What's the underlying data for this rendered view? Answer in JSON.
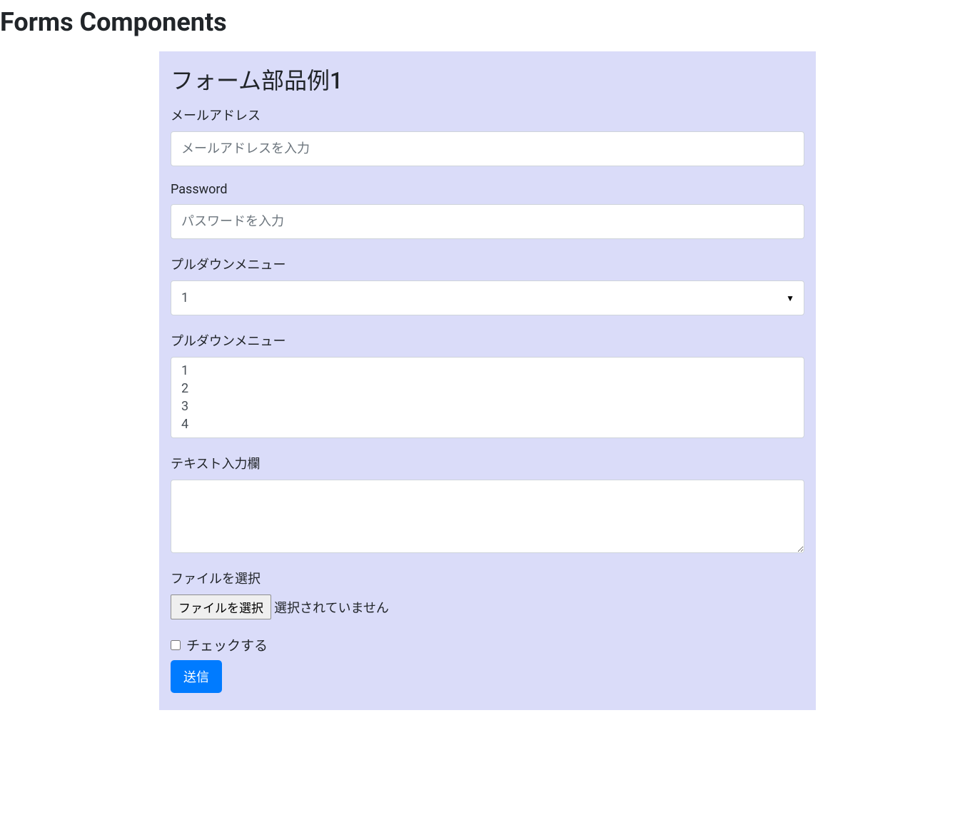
{
  "page": {
    "title": "Forms Components"
  },
  "form": {
    "header": "フォーム部品例1",
    "email": {
      "label": "メールアドレス",
      "placeholder": "メールアドレスを入力"
    },
    "password": {
      "label": "Password",
      "placeholder": "パスワードを入力"
    },
    "select_single": {
      "label": "プルダウンメニュー",
      "selected": "1"
    },
    "select_multiple": {
      "label": "プルダウンメニュー",
      "options": [
        "1",
        "2",
        "3",
        "4"
      ]
    },
    "textarea": {
      "label": "テキスト入力欄"
    },
    "file": {
      "label": "ファイルを選択",
      "button": "ファイルを選択",
      "status": "選択されていません"
    },
    "checkbox": {
      "label": "チェックする"
    },
    "submit": {
      "label": "送信"
    }
  }
}
